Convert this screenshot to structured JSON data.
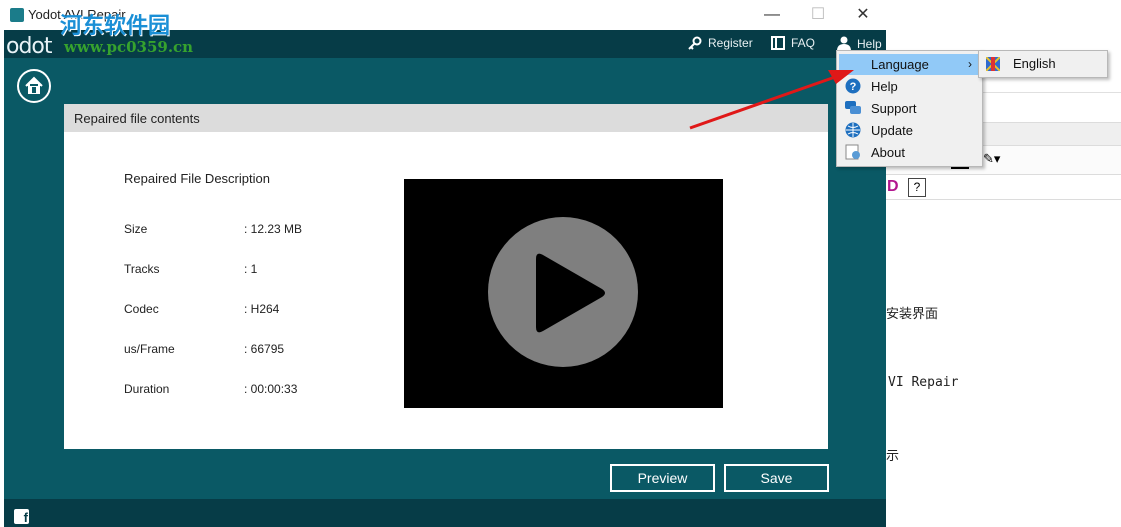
{
  "window": {
    "title": "Yodot AVI Repair",
    "minimize": "—",
    "maximize": "☐",
    "close": "✕"
  },
  "watermark": {
    "brand": "河东软件园",
    "url": "www.pc0359.cn",
    "logo": "odot"
  },
  "topbar": {
    "register": "Register",
    "faq": "FAQ",
    "help": "Help"
  },
  "panel": {
    "header": "Repaired file contents",
    "description_title": "Repaired File Description",
    "rows": [
      {
        "label": "Size",
        "value": ": 12.23 MB"
      },
      {
        "label": "Tracks",
        "value": ": 1"
      },
      {
        "label": "Codec",
        "value": ": H264"
      },
      {
        "label": "us/Frame",
        "value": ": 66795"
      },
      {
        "label": "Duration",
        "value": ": 00:00:33"
      }
    ]
  },
  "buttons": {
    "preview": "Preview",
    "save": "Save"
  },
  "menu": {
    "items": [
      {
        "label": "Language",
        "icon": "none",
        "submenu_arrow": "›"
      },
      {
        "label": "Help",
        "icon": "question-icon"
      },
      {
        "label": "Support",
        "icon": "chat-icon"
      },
      {
        "label": "Update",
        "icon": "globe-icon"
      },
      {
        "label": "About",
        "icon": "about-icon"
      }
    ],
    "language_submenu": {
      "label": "English"
    }
  },
  "background": {
    "line1": "安装界面",
    "line2": "VI Repair",
    "line3": "示",
    "d_label": "D",
    "q_label": "?"
  },
  "colors": {
    "window_bg": "#0a5965",
    "topbar_bg": "#063c47",
    "menu_highlight": "#91c9f7",
    "arrow": "#e01818"
  }
}
